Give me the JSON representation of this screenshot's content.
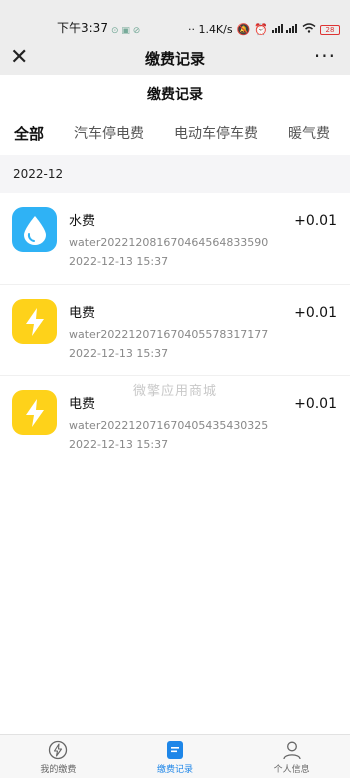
{
  "status_bar": {
    "time": "下午3:37",
    "notif_icons": "⊙ ▣ ⊘",
    "net_speed": "·· 1.4K/s",
    "battery": "28"
  },
  "navbar": {
    "title": "缴费记录"
  },
  "page": {
    "heading": "缴费记录"
  },
  "tabs": [
    {
      "label": "全部",
      "active": true
    },
    {
      "label": "汽车停电费",
      "active": false
    },
    {
      "label": "电动车停车费",
      "active": false
    },
    {
      "label": "暖气费",
      "active": false
    }
  ],
  "month_group": "2022-12",
  "records": [
    {
      "icon": "water-drop-icon",
      "name": "水费",
      "order": "water20221208167046456483359​0",
      "date": "2022-12-13 15:37",
      "amount": "+0.01"
    },
    {
      "icon": "lightning-icon",
      "name": "电费",
      "order": "water2022120716704055783171​77",
      "date": "2022-12-13 15:37",
      "amount": "+0.01"
    },
    {
      "icon": "lightning-icon",
      "name": "电费",
      "order": "water2022120716704054354303​25",
      "date": "2022-12-13 15:37",
      "amount": "+0.01"
    }
  ],
  "watermark": "微擎应用商城",
  "bottom_nav": [
    {
      "label": "我的缴费",
      "icon": "lightning-circle-icon",
      "active": false
    },
    {
      "label": "缴费记录",
      "icon": "document-icon",
      "active": true
    },
    {
      "label": "个人信息",
      "icon": "person-icon",
      "active": false
    }
  ],
  "colors": {
    "water": "#2fb2f5",
    "power": "#fed21a",
    "accent": "#1e86e8"
  }
}
